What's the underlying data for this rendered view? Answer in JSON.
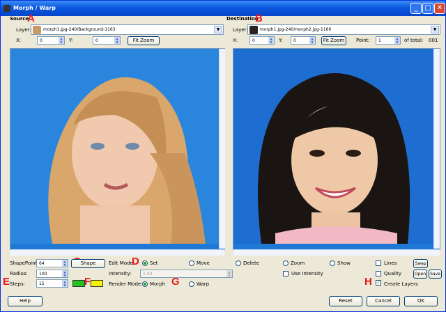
{
  "window": {
    "title": "Morph / Warp"
  },
  "source": {
    "section_label": "Source",
    "layer_label": "Layer:",
    "layer_value": "morph1.jpg-240/Background-1163",
    "x_label": "X:",
    "x_value": "0",
    "y_label": "Y:",
    "y_value": "0",
    "fit_zoom": "Fit Zoom"
  },
  "destination": {
    "section_label": "Destination",
    "layer_label": "Layer:",
    "layer_value": "morph1.jpg-240/morph2.jpg-1166",
    "x_label": "X:",
    "x_value": "0",
    "y_label": "Y:",
    "y_value": "0",
    "fit_zoom": "Fit Zoom",
    "point_label": "Point:",
    "point_value": "1",
    "of_total_label": "of total:",
    "of_total_value": "001"
  },
  "controls": {
    "shapepoints_label": "ShapePoints:",
    "shapepoints_value": "64",
    "radius_label": "Radius:",
    "radius_value": "100",
    "steps_label": "Steps:",
    "steps_value": "15",
    "shape_button": "Shape",
    "edit_mode_label": "Edit Mode:",
    "set_label": "Set",
    "move_label": "Move",
    "delete_label": "Delete",
    "zoom_label": "Zoom",
    "show_label": "Show",
    "intensity_label": "Intensity:",
    "intensity_value": "1.00",
    "use_intensity_label": "Use Intensity",
    "render_mode_label": "Render Mode:",
    "morph_label": "Morph",
    "warp_label": "Warp",
    "lines_label": "Lines",
    "quality_label": "Quality",
    "create_layers_label": "Create Layers",
    "swap_button": "Swap",
    "open_button": "Open",
    "save_button": "Save",
    "color1": "#22c41c",
    "color2": "#f5f500"
  },
  "footer": {
    "help": "Help",
    "reset": "Reset",
    "cancel": "Cancel",
    "ok": "OK"
  },
  "annotations": {
    "a": "A",
    "b": "B",
    "c": "C",
    "d": "D",
    "e": "E",
    "f": "F",
    "g": "G",
    "h": "H"
  }
}
